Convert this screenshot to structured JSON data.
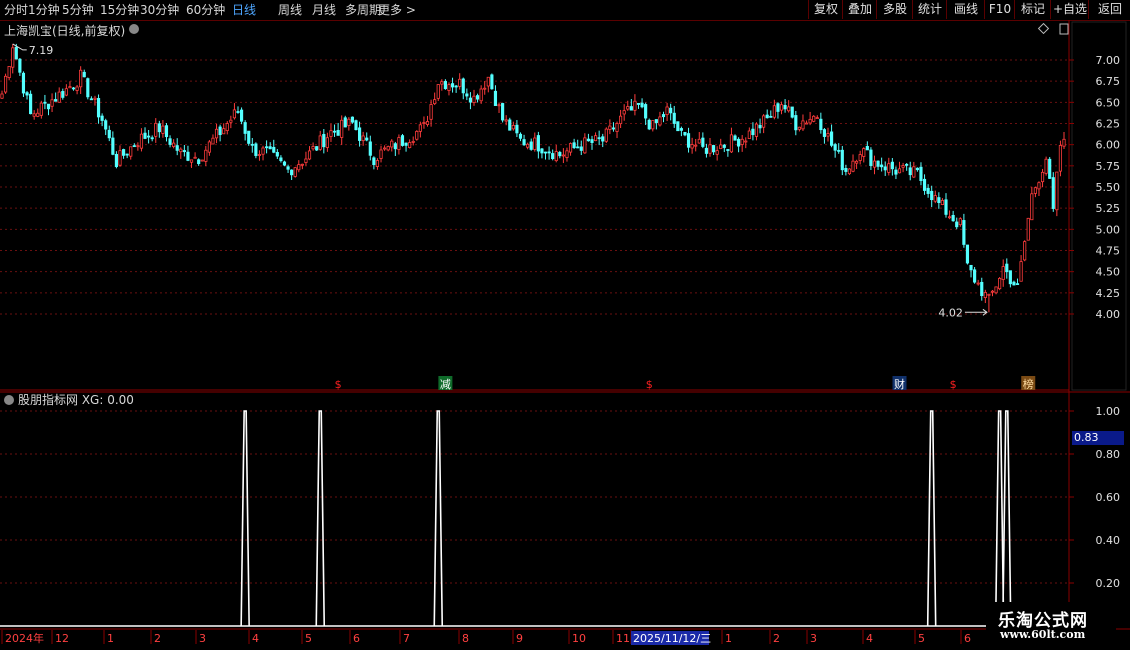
{
  "toolbar": {
    "periods": [
      "分时",
      "1分钟",
      "5分钟",
      "15分钟",
      "30分钟",
      "60分钟",
      "日线",
      "周线",
      "月线",
      "多周期",
      "更多 >"
    ],
    "active_period": "日线",
    "right_buttons": [
      "复权",
      "叠加",
      "多股",
      "统计",
      "画线",
      "F10",
      "标记",
      "+自选",
      "返回"
    ]
  },
  "main_chart": {
    "title": "上海凯宝(日线,前复权)",
    "high_label": "7.19",
    "low_label": "4.02",
    "y_ticks": [
      "7.00",
      "6.75",
      "6.50",
      "6.25",
      "6.00",
      "5.75",
      "5.50",
      "5.25",
      "5.00",
      "4.75",
      "4.50",
      "4.25",
      "4.00"
    ],
    "markers": [
      {
        "text": "$",
        "kind": "dollar",
        "idx": 94
      },
      {
        "text": "减",
        "kind": "jian",
        "idx": 124
      },
      {
        "text": "$",
        "kind": "dollar",
        "idx": 181
      },
      {
        "text": "财",
        "kind": "cai",
        "idx": 251
      },
      {
        "text": "$",
        "kind": "dollar",
        "idx": 266
      },
      {
        "text": "榜",
        "kind": "bang",
        "idx": 287
      }
    ],
    "colors": {
      "up": "#ff3c3c",
      "down": "#54ffff",
      "grid": "#6a1010",
      "axis": "#8a0000"
    }
  },
  "indicator": {
    "title": "股朋指标网 XG: 0.00",
    "current_value": "0.83",
    "y_ticks": [
      "1.00",
      "0.80",
      "0.60",
      "0.40",
      "0.20"
    ],
    "signal_indices": [
      68,
      89,
      122,
      260,
      279,
      281
    ]
  },
  "x_axis": {
    "labels": [
      "2024年",
      "12",
      "1",
      "2",
      "3",
      "4",
      "5",
      "6",
      "7",
      "8",
      "9",
      "10",
      "11",
      "2025/11/12/三",
      "1",
      "2",
      "3",
      "4",
      "5",
      "6"
    ]
  },
  "watermark": {
    "line1": "乐淘公式网",
    "line2": "www.60lt.com"
  },
  "chart_data": {
    "type": "candlestick",
    "title": "上海凯宝(日线,前复权)",
    "y_range": [
      4.0,
      7.19
    ],
    "anchors": [
      [
        0,
        6.6
      ],
      [
        3,
        7.19
      ],
      [
        8,
        6.35
      ],
      [
        13,
        6.5
      ],
      [
        18,
        6.65
      ],
      [
        22,
        6.8
      ],
      [
        28,
        6.3
      ],
      [
        32,
        5.8
      ],
      [
        38,
        6.05
      ],
      [
        44,
        6.2
      ],
      [
        50,
        5.9
      ],
      [
        55,
        5.85
      ],
      [
        60,
        6.1
      ],
      [
        66,
        6.4
      ],
      [
        70,
        5.95
      ],
      [
        74,
        5.9
      ],
      [
        80,
        5.7
      ],
      [
        85,
        5.85
      ],
      [
        92,
        6.15
      ],
      [
        98,
        6.25
      ],
      [
        104,
        5.85
      ],
      [
        110,
        6.0
      ],
      [
        118,
        6.2
      ],
      [
        122,
        6.75
      ],
      [
        128,
        6.72
      ],
      [
        132,
        6.55
      ],
      [
        136,
        6.8
      ],
      [
        140,
        6.3
      ],
      [
        145,
        6.05
      ],
      [
        150,
        6.0
      ],
      [
        156,
        5.88
      ],
      [
        162,
        6.0
      ],
      [
        168,
        6.05
      ],
      [
        174,
        6.35
      ],
      [
        178,
        6.45
      ],
      [
        182,
        6.2
      ],
      [
        186,
        6.4
      ],
      [
        190,
        6.1
      ],
      [
        196,
        5.95
      ],
      [
        202,
        6.0
      ],
      [
        208,
        6.1
      ],
      [
        214,
        6.3
      ],
      [
        218,
        6.5
      ],
      [
        222,
        6.25
      ],
      [
        228,
        6.35
      ],
      [
        232,
        6.0
      ],
      [
        236,
        5.7
      ],
      [
        240,
        5.95
      ],
      [
        244,
        5.8
      ],
      [
        250,
        5.7
      ],
      [
        256,
        5.65
      ],
      [
        262,
        5.3
      ],
      [
        268,
        5.05
      ],
      [
        270,
        4.55
      ],
      [
        276,
        4.15
      ],
      [
        280,
        4.55
      ],
      [
        284,
        4.3
      ],
      [
        288,
        5.4
      ],
      [
        292,
        5.85
      ],
      [
        294,
        5.2
      ],
      [
        296,
        6.0
      ]
    ]
  }
}
